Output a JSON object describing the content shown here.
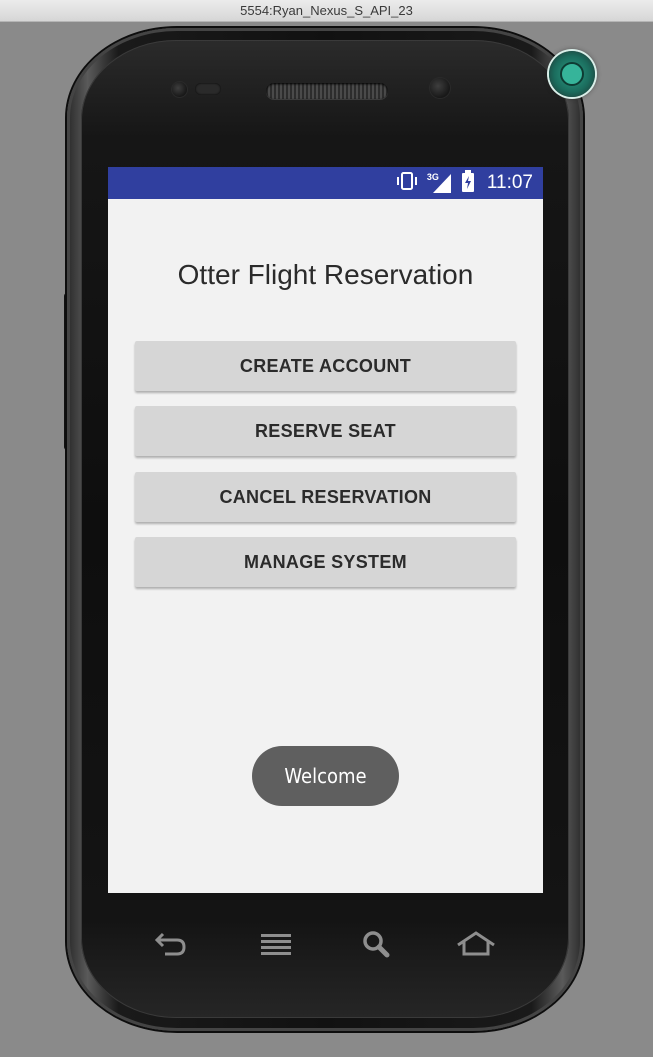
{
  "window": {
    "title": "5554:Ryan_Nexus_S_API_23"
  },
  "status_bar": {
    "network_label": "3G",
    "time": "11:07",
    "color": "#303f9f"
  },
  "app": {
    "title": "Otter Flight Reservation",
    "buttons": [
      {
        "label": "CREATE ACCOUNT"
      },
      {
        "label": "RESERVE SEAT"
      },
      {
        "label": "CANCEL RESERVATION"
      },
      {
        "label": "MANAGE SYSTEM"
      }
    ],
    "toast": "Welcome"
  },
  "hardware_nav": {
    "icons": [
      "back-icon",
      "menu-icon",
      "search-icon",
      "home-icon"
    ]
  }
}
